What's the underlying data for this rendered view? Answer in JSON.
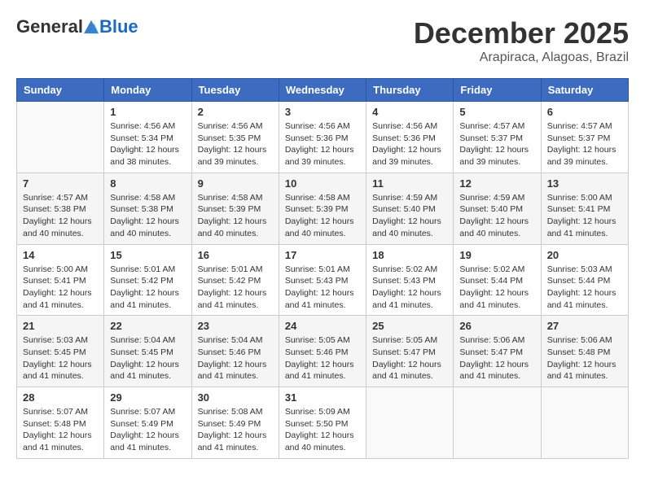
{
  "logo": {
    "general": "General",
    "blue": "Blue"
  },
  "header": {
    "month": "December 2025",
    "location": "Arapiraca, Alagoas, Brazil"
  },
  "days_of_week": [
    "Sunday",
    "Monday",
    "Tuesday",
    "Wednesday",
    "Thursday",
    "Friday",
    "Saturday"
  ],
  "weeks": [
    [
      {
        "day": "",
        "info": ""
      },
      {
        "day": "1",
        "info": "Sunrise: 4:56 AM\nSunset: 5:34 PM\nDaylight: 12 hours\nand 38 minutes."
      },
      {
        "day": "2",
        "info": "Sunrise: 4:56 AM\nSunset: 5:35 PM\nDaylight: 12 hours\nand 39 minutes."
      },
      {
        "day": "3",
        "info": "Sunrise: 4:56 AM\nSunset: 5:36 PM\nDaylight: 12 hours\nand 39 minutes."
      },
      {
        "day": "4",
        "info": "Sunrise: 4:56 AM\nSunset: 5:36 PM\nDaylight: 12 hours\nand 39 minutes."
      },
      {
        "day": "5",
        "info": "Sunrise: 4:57 AM\nSunset: 5:37 PM\nDaylight: 12 hours\nand 39 minutes."
      },
      {
        "day": "6",
        "info": "Sunrise: 4:57 AM\nSunset: 5:37 PM\nDaylight: 12 hours\nand 39 minutes."
      }
    ],
    [
      {
        "day": "7",
        "info": "Sunrise: 4:57 AM\nSunset: 5:38 PM\nDaylight: 12 hours\nand 40 minutes."
      },
      {
        "day": "8",
        "info": "Sunrise: 4:58 AM\nSunset: 5:38 PM\nDaylight: 12 hours\nand 40 minutes."
      },
      {
        "day": "9",
        "info": "Sunrise: 4:58 AM\nSunset: 5:39 PM\nDaylight: 12 hours\nand 40 minutes."
      },
      {
        "day": "10",
        "info": "Sunrise: 4:58 AM\nSunset: 5:39 PM\nDaylight: 12 hours\nand 40 minutes."
      },
      {
        "day": "11",
        "info": "Sunrise: 4:59 AM\nSunset: 5:40 PM\nDaylight: 12 hours\nand 40 minutes."
      },
      {
        "day": "12",
        "info": "Sunrise: 4:59 AM\nSunset: 5:40 PM\nDaylight: 12 hours\nand 40 minutes."
      },
      {
        "day": "13",
        "info": "Sunrise: 5:00 AM\nSunset: 5:41 PM\nDaylight: 12 hours\nand 41 minutes."
      }
    ],
    [
      {
        "day": "14",
        "info": "Sunrise: 5:00 AM\nSunset: 5:41 PM\nDaylight: 12 hours\nand 41 minutes."
      },
      {
        "day": "15",
        "info": "Sunrise: 5:01 AM\nSunset: 5:42 PM\nDaylight: 12 hours\nand 41 minutes."
      },
      {
        "day": "16",
        "info": "Sunrise: 5:01 AM\nSunset: 5:42 PM\nDaylight: 12 hours\nand 41 minutes."
      },
      {
        "day": "17",
        "info": "Sunrise: 5:01 AM\nSunset: 5:43 PM\nDaylight: 12 hours\nand 41 minutes."
      },
      {
        "day": "18",
        "info": "Sunrise: 5:02 AM\nSunset: 5:43 PM\nDaylight: 12 hours\nand 41 minutes."
      },
      {
        "day": "19",
        "info": "Sunrise: 5:02 AM\nSunset: 5:44 PM\nDaylight: 12 hours\nand 41 minutes."
      },
      {
        "day": "20",
        "info": "Sunrise: 5:03 AM\nSunset: 5:44 PM\nDaylight: 12 hours\nand 41 minutes."
      }
    ],
    [
      {
        "day": "21",
        "info": "Sunrise: 5:03 AM\nSunset: 5:45 PM\nDaylight: 12 hours\nand 41 minutes."
      },
      {
        "day": "22",
        "info": "Sunrise: 5:04 AM\nSunset: 5:45 PM\nDaylight: 12 hours\nand 41 minutes."
      },
      {
        "day": "23",
        "info": "Sunrise: 5:04 AM\nSunset: 5:46 PM\nDaylight: 12 hours\nand 41 minutes."
      },
      {
        "day": "24",
        "info": "Sunrise: 5:05 AM\nSunset: 5:46 PM\nDaylight: 12 hours\nand 41 minutes."
      },
      {
        "day": "25",
        "info": "Sunrise: 5:05 AM\nSunset: 5:47 PM\nDaylight: 12 hours\nand 41 minutes."
      },
      {
        "day": "26",
        "info": "Sunrise: 5:06 AM\nSunset: 5:47 PM\nDaylight: 12 hours\nand 41 minutes."
      },
      {
        "day": "27",
        "info": "Sunrise: 5:06 AM\nSunset: 5:48 PM\nDaylight: 12 hours\nand 41 minutes."
      }
    ],
    [
      {
        "day": "28",
        "info": "Sunrise: 5:07 AM\nSunset: 5:48 PM\nDaylight: 12 hours\nand 41 minutes."
      },
      {
        "day": "29",
        "info": "Sunrise: 5:07 AM\nSunset: 5:49 PM\nDaylight: 12 hours\nand 41 minutes."
      },
      {
        "day": "30",
        "info": "Sunrise: 5:08 AM\nSunset: 5:49 PM\nDaylight: 12 hours\nand 41 minutes."
      },
      {
        "day": "31",
        "info": "Sunrise: 5:09 AM\nSunset: 5:50 PM\nDaylight: 12 hours\nand 40 minutes."
      },
      {
        "day": "",
        "info": ""
      },
      {
        "day": "",
        "info": ""
      },
      {
        "day": "",
        "info": ""
      }
    ]
  ]
}
